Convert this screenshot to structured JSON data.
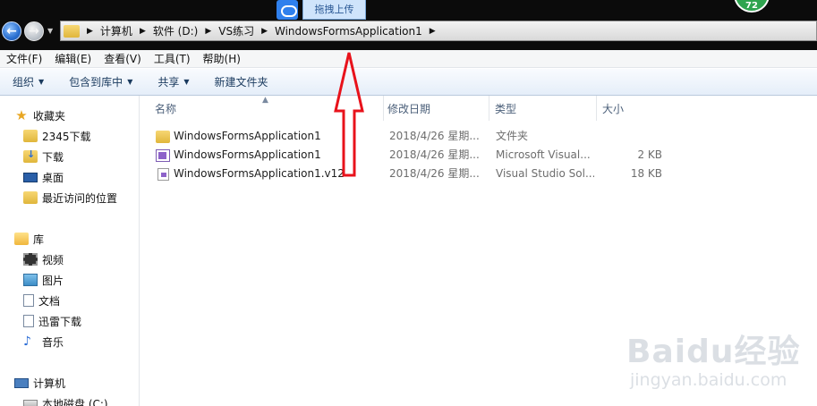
{
  "address": {
    "breadcrumbs": [
      "计算机",
      "软件 (D:)",
      "VS练习",
      "WindowsFormsApplication1"
    ]
  },
  "upload_tab": {
    "label": "拖拽上传"
  },
  "badge": {
    "value": "72"
  },
  "menu": [
    "文件(F)",
    "编辑(E)",
    "查看(V)",
    "工具(T)",
    "帮助(H)"
  ],
  "toolbar": [
    {
      "label": "组织",
      "has_dropdown": true
    },
    {
      "label": "包含到库中",
      "has_dropdown": true
    },
    {
      "label": "共享",
      "has_dropdown": true
    },
    {
      "label": "新建文件夹",
      "has_dropdown": false
    }
  ],
  "sidebar": {
    "favorites": {
      "label": "收藏夹",
      "icon": "star-icon",
      "items": [
        {
          "label": "2345下载",
          "icon": "folder-icon"
        },
        {
          "label": "下载",
          "icon": "download-folder-icon"
        },
        {
          "label": "桌面",
          "icon": "desktop-icon"
        },
        {
          "label": "最近访问的位置",
          "icon": "recent-places-icon"
        }
      ]
    },
    "libraries": {
      "label": "库",
      "icon": "library-icon",
      "items": [
        {
          "label": "视频",
          "icon": "video-library-icon"
        },
        {
          "label": "图片",
          "icon": "picture-library-icon"
        },
        {
          "label": "文档",
          "icon": "document-library-icon"
        },
        {
          "label": "迅雷下载",
          "icon": "thunder-download-icon"
        },
        {
          "label": "音乐",
          "icon": "music-library-icon"
        }
      ]
    },
    "computer": {
      "label": "计算机",
      "icon": "computer-icon",
      "items": [
        {
          "label": "本地磁盘 (C:)",
          "icon": "drive-icon"
        }
      ]
    }
  },
  "columns": [
    "名称",
    "修改日期",
    "类型",
    "大小"
  ],
  "files": [
    {
      "name": "WindowsFormsApplication1",
      "date": "2018/4/26 星期...",
      "type": "文件夹",
      "size": "",
      "icon": "folder-icon"
    },
    {
      "name": "WindowsFormsApplication1",
      "date": "2018/4/26 星期...",
      "type": "Microsoft Visual...",
      "size": "2 KB",
      "icon": "csharp-project-icon"
    },
    {
      "name": "WindowsFormsApplication1.v12",
      "date": "2018/4/26 星期...",
      "type": "Visual Studio Sol...",
      "size": "18 KB",
      "icon": "solution-file-icon"
    }
  ],
  "watermark": {
    "logo": "Baidu经验",
    "url": "jingyan.baidu.com"
  },
  "colors": {
    "toolbar_bg": "#e5eef9",
    "titlebar_bg": "#0b0b0b",
    "annotation_arrow": "#e8121b",
    "column_header_text": "#4c607a"
  }
}
